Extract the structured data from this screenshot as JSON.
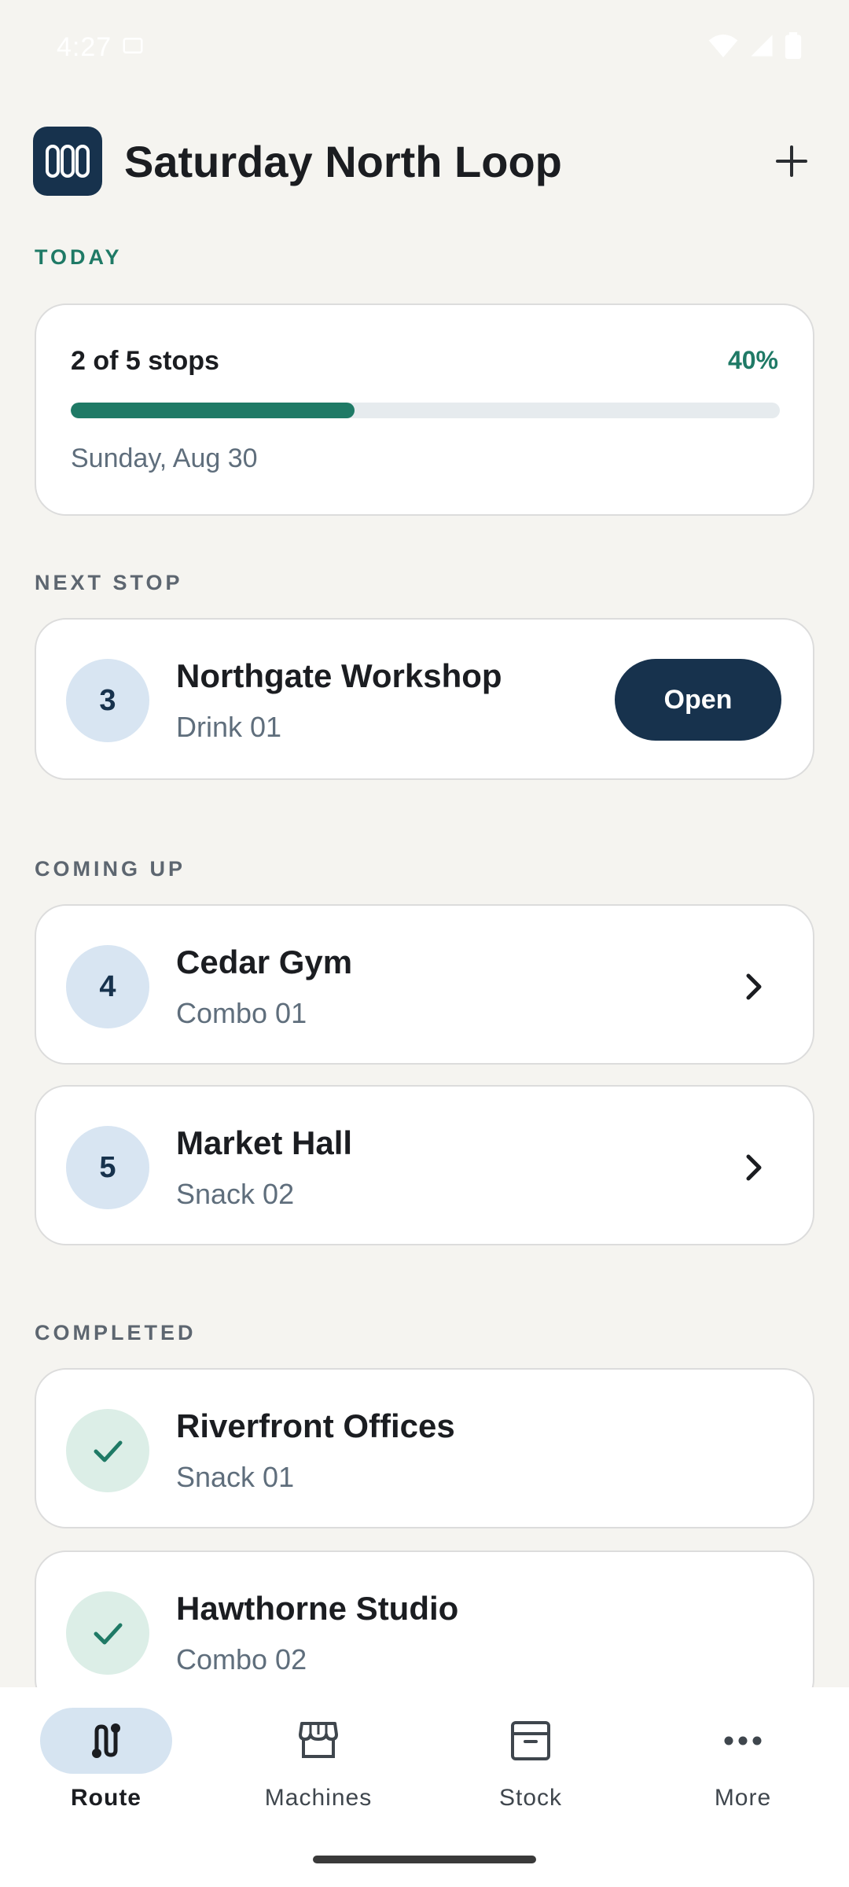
{
  "status_bar": {
    "time": "4:27"
  },
  "header": {
    "title": "Saturday North Loop"
  },
  "today": {
    "label": "TODAY",
    "progress_text": "2 of 5 stops",
    "percent_text": "40%",
    "progress_fraction": 0.4,
    "date": "Sunday, Aug 30"
  },
  "next_stop": {
    "label": "NEXT STOP",
    "number": "3",
    "name": "Northgate Workshop",
    "machine": "Drink 01",
    "open_label": "Open"
  },
  "coming_up": {
    "label": "COMING UP",
    "stops": [
      {
        "number": "4",
        "name": "Cedar Gym",
        "machine": "Combo 01"
      },
      {
        "number": "5",
        "name": "Market Hall",
        "machine": "Snack 02"
      }
    ]
  },
  "completed": {
    "label": "COMPLETED",
    "stops": [
      {
        "name": "Riverfront Offices",
        "machine": "Snack 01"
      },
      {
        "name": "Hawthorne Studio",
        "machine": "Combo 02"
      }
    ]
  },
  "nav": {
    "items": [
      {
        "label": "Route",
        "icon": "route-icon",
        "active": true
      },
      {
        "label": "Machines",
        "icon": "storefront-icon",
        "active": false
      },
      {
        "label": "Stock",
        "icon": "archive-box-icon",
        "active": false
      },
      {
        "label": "More",
        "icon": "more-horizontal-icon",
        "active": false
      }
    ]
  },
  "colors": {
    "accent": "#1f7a66",
    "primary": "#17324d",
    "background": "#f5f4f0",
    "badge": "#d8e5f2",
    "done_badge": "#dceee7"
  }
}
